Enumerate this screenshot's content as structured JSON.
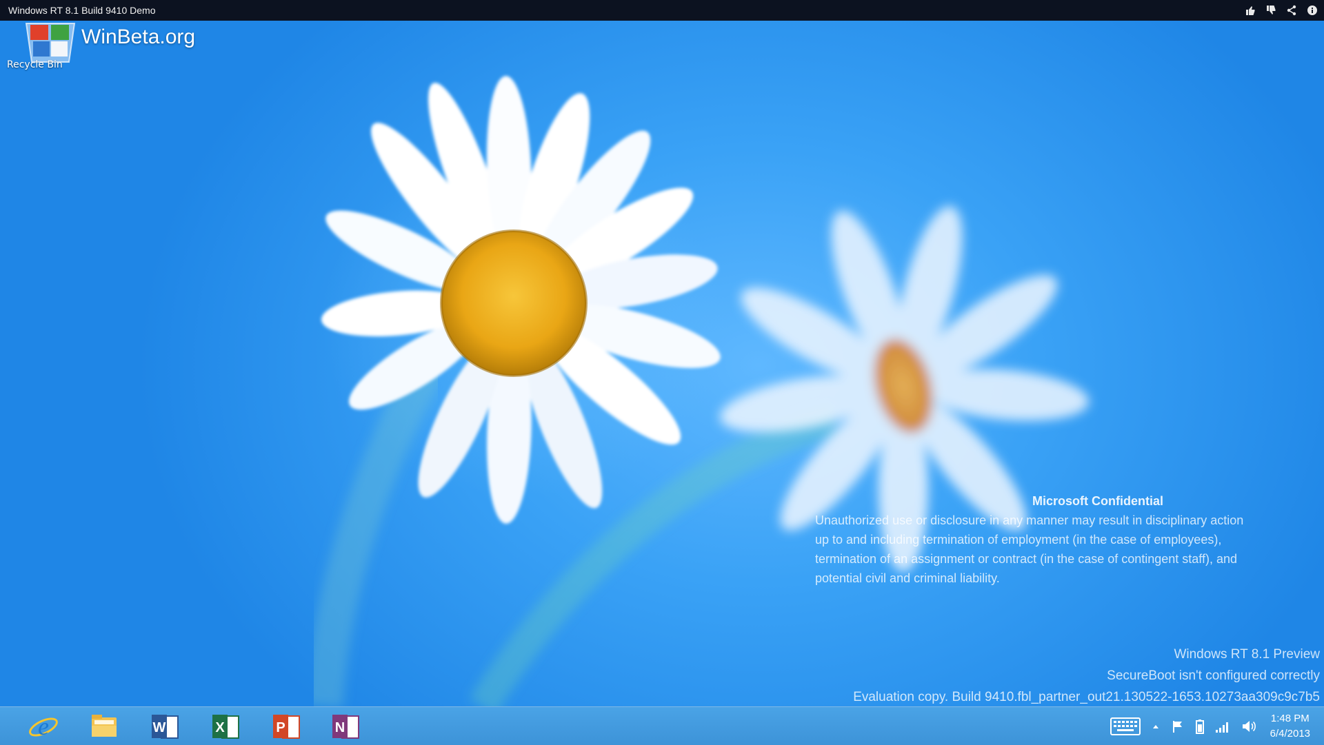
{
  "window": {
    "title": "Windows RT 8.1 Build 9410 Demo",
    "actions": [
      {
        "name": "thumbs-up-icon"
      },
      {
        "name": "thumbs-down-icon"
      },
      {
        "name": "share-icon"
      },
      {
        "name": "info-icon"
      }
    ]
  },
  "desktop": {
    "recycle_bin_label": "Recycle Bin",
    "watermark": "WinBeta.org",
    "confidential": {
      "title": "Microsoft Confidential",
      "lines": [
        "Unauthorized use or disclosure in any manner may result in disciplinary action",
        "up to and including termination of employment (in the case of employees),",
        "termination of an assignment or contract (in the case of contingent staff), and",
        "potential civil and criminal liability."
      ]
    },
    "build_info": [
      "Windows RT 8.1 Preview",
      "SecureBoot isn't configured correctly",
      "Evaluation copy. Build 9410.fbl_partner_out21.130522-1653.10273aa309c9c7b5"
    ]
  },
  "taskbar": {
    "apps": [
      {
        "name": "internet-explorer-icon"
      },
      {
        "name": "file-explorer-icon"
      },
      {
        "name": "word-icon",
        "letter": "W",
        "color": "#2b5797"
      },
      {
        "name": "excel-icon",
        "letter": "X",
        "color": "#1e7145"
      },
      {
        "name": "powerpoint-icon",
        "letter": "P",
        "color": "#d24726"
      },
      {
        "name": "onenote-icon",
        "letter": "N",
        "color": "#80397b"
      }
    ],
    "tray": {
      "time": "1:48 PM",
      "date": "6/4/2013"
    }
  }
}
